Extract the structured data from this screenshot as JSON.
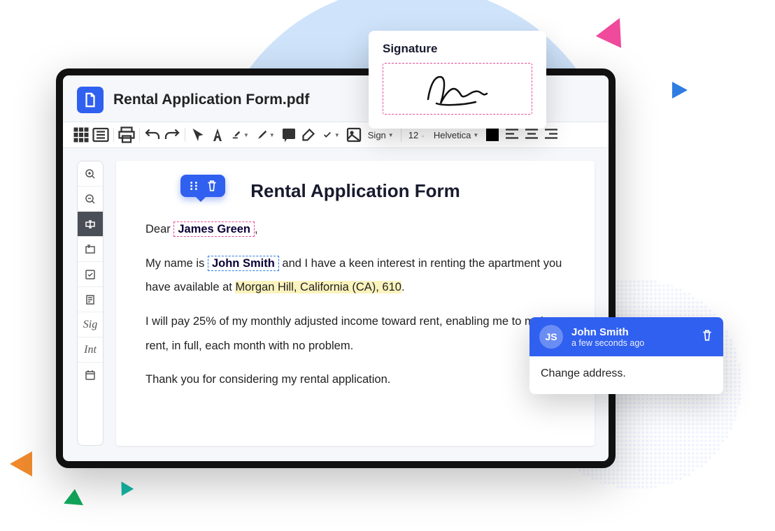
{
  "app": {
    "filename": "Rental Application Form.pdf"
  },
  "toolbar": {
    "sign_label": "Sign",
    "font_size": "12",
    "font_family": "Helvetica"
  },
  "document": {
    "title": "Rental Application Form",
    "greeting": "Dear",
    "greeting_after": ",",
    "recipient": "James Green",
    "intro_1": "My name is",
    "sender": "John Smith",
    "intro_2": "and I have a keen interest in renting the apartment you have available at",
    "address": "Morgan Hill, California (CA), 610",
    "intro_end": ".",
    "para2": "I will pay 25% of my monthly adjusted income toward rent, enabling me to make rent, in full, each month with no problem.",
    "para3": "Thank you for considering my rental application."
  },
  "signature": {
    "label": "Signature"
  },
  "comment": {
    "initials": "JS",
    "author": "John Smith",
    "timestamp": "a few seconds ago",
    "text": "Change address."
  }
}
